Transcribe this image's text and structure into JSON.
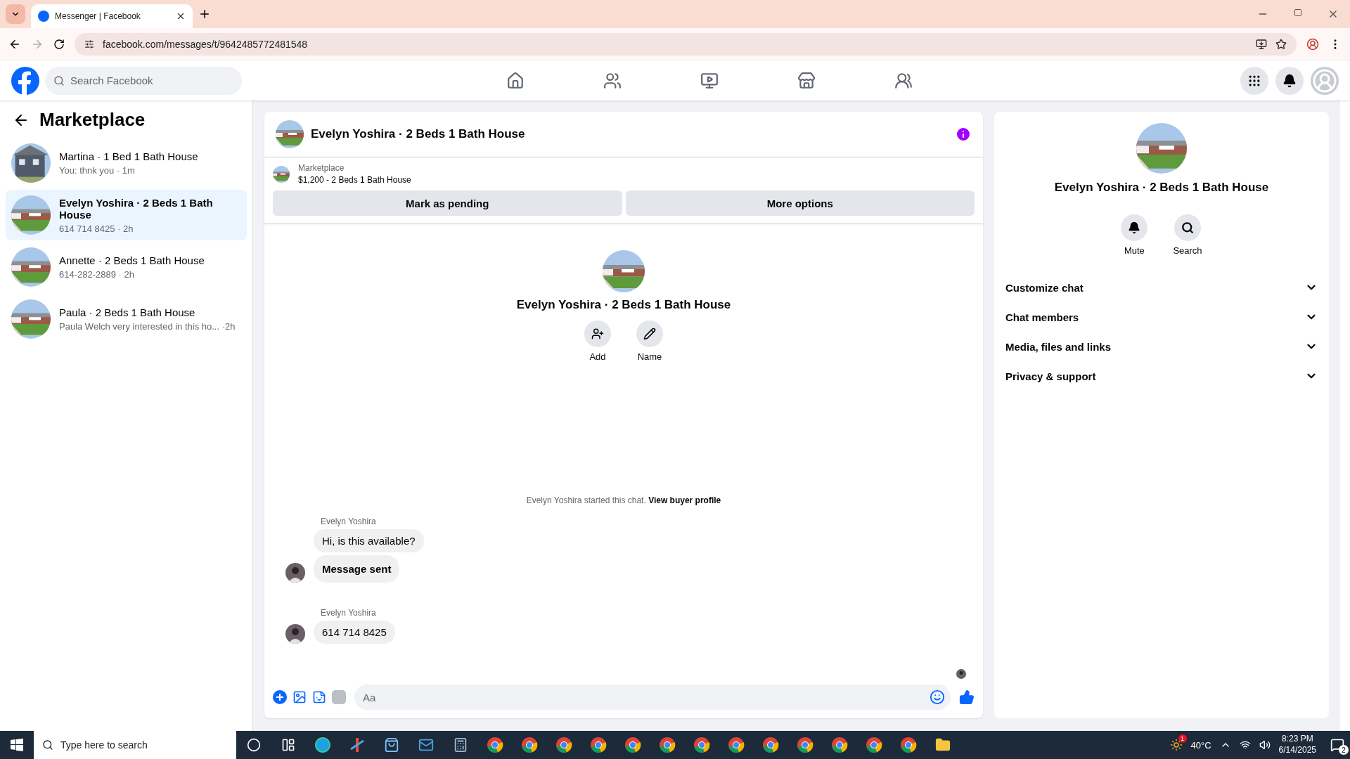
{
  "browser": {
    "tab_title": "Messenger | Facebook",
    "url": "facebook.com/messages/t/9642485772481548"
  },
  "header": {
    "search_placeholder": "Search Facebook",
    "nav": [
      {
        "kind": "home"
      },
      {
        "kind": "friends"
      },
      {
        "kind": "video"
      },
      {
        "kind": "marketplace"
      },
      {
        "kind": "groups"
      }
    ]
  },
  "sidebar": {
    "title": "Marketplace",
    "conversations": [
      {
        "name": "Martina · 1 Bed 1 Bath House",
        "preview": "You: thnk you · 1m",
        "selected": false
      },
      {
        "name": "Evelyn Yoshira · 2 Beds 1 Bath House",
        "preview": "614 714 8425 · 2h",
        "selected": true
      },
      {
        "name": "Annette · 2 Beds 1 Bath House",
        "preview": "614-282-2889 · 2h",
        "selected": false
      },
      {
        "name": "Paula · 2 Beds 1 Bath House",
        "preview": "Paula Welch very interested in this ho... ·2h",
        "selected": false
      }
    ]
  },
  "chat": {
    "title": "Evelyn Yoshira · 2 Beds 1 Bath House",
    "listing": {
      "label": "Marketplace",
      "detail": "$1,200 - 2 Beds 1 Bath House"
    },
    "actions": [
      "Mark as pending",
      "More options"
    ],
    "intro": {
      "title": "Evelyn Yoshira · 2 Beds 1 Bath House",
      "actions": [
        {
          "kind": "add",
          "label": "Add"
        },
        {
          "kind": "name",
          "label": "Name"
        }
      ]
    },
    "notice": {
      "text": "Evelyn Yoshira started this chat.",
      "link": "View buyer profile"
    },
    "groups": [
      {
        "sender": "Evelyn Yoshira",
        "messages": [
          {
            "kind": "text",
            "text": "Hi, is this available?"
          },
          {
            "kind": "status",
            "text": "Message sent"
          }
        ]
      },
      {
        "sender": "Evelyn Yoshira",
        "messages": [
          {
            "kind": "text",
            "text": "614 714 8425"
          }
        ]
      }
    ],
    "composer": {
      "placeholder": "Aa"
    }
  },
  "details": {
    "title": "Evelyn Yoshira · 2 Beds 1 Bath House",
    "actions": [
      {
        "kind": "mute",
        "label": "Mute"
      },
      {
        "kind": "search",
        "label": "Search"
      }
    ],
    "sections": [
      {
        "label": "Customize chat",
        "expanded": false
      },
      {
        "label": "Chat members",
        "expanded": false
      },
      {
        "label": "Media, files and links",
        "expanded": false
      },
      {
        "label": "Privacy & support",
        "expanded": false
      }
    ]
  },
  "taskbar": {
    "search_placeholder": "Type here to search",
    "apps": [
      {
        "kind": "cortana"
      },
      {
        "kind": "taskview"
      },
      {
        "kind": "edge"
      },
      {
        "kind": "app"
      },
      {
        "kind": "store"
      },
      {
        "kind": "mail"
      },
      {
        "kind": "calculator"
      },
      {
        "kind": "chrome"
      },
      {
        "kind": "chrome"
      },
      {
        "kind": "chrome"
      },
      {
        "kind": "chrome"
      },
      {
        "kind": "chrome"
      },
      {
        "kind": "chrome"
      },
      {
        "kind": "chrome"
      },
      {
        "kind": "chrome"
      },
      {
        "kind": "chrome"
      },
      {
        "kind": "chrome"
      },
      {
        "kind": "chrome"
      },
      {
        "kind": "chrome"
      },
      {
        "kind": "chrome"
      },
      {
        "kind": "explorer"
      }
    ],
    "weather_badge": "1",
    "temperature": "40°C",
    "time": "8:23 PM",
    "date": "6/14/2025",
    "notifications": "2"
  }
}
